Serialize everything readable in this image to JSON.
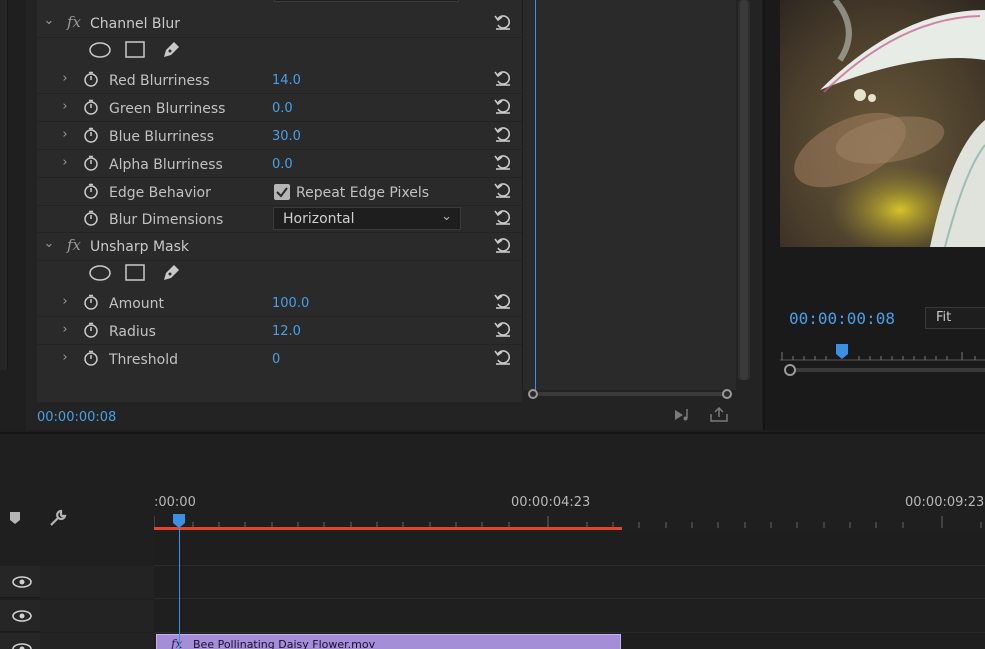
{
  "effect_controls": {
    "effects": [
      {
        "name": "Channel Blur",
        "properties": [
          {
            "label": "Red Blurriness",
            "value": "14.0"
          },
          {
            "label": "Green Blurriness",
            "value": "0.0"
          },
          {
            "label": "Blue Blurriness",
            "value": "30.0"
          },
          {
            "label": "Alpha Blurriness",
            "value": "0.0"
          },
          {
            "label": "Edge Behavior",
            "checkbox_label": "Repeat Edge Pixels",
            "checked": true
          },
          {
            "label": "Blur Dimensions",
            "dropdown_value": "Horizontal"
          }
        ]
      },
      {
        "name": "Unsharp Mask",
        "properties": [
          {
            "label": "Amount",
            "value": "100.0"
          },
          {
            "label": "Radius",
            "value": "12.0"
          },
          {
            "label": "Threshold",
            "value": "0"
          }
        ]
      }
    ],
    "fx_glyph": "fx",
    "footer_timecode": "00:00:00:08"
  },
  "program_monitor": {
    "timecode": "00:00:00:08",
    "fit_label": "Fit"
  },
  "timeline": {
    "ruler_labels": [
      ":00:00",
      "00:00:04:23",
      "00:00:09:23"
    ],
    "clip_name": "Bee Pollinating Daisy Flower.mov",
    "clip_fx": "fx"
  },
  "colors": {
    "accent_blue": "#4a9fe8",
    "work_area_red": "#e2462f",
    "clip_purple": "#a48ed8"
  }
}
